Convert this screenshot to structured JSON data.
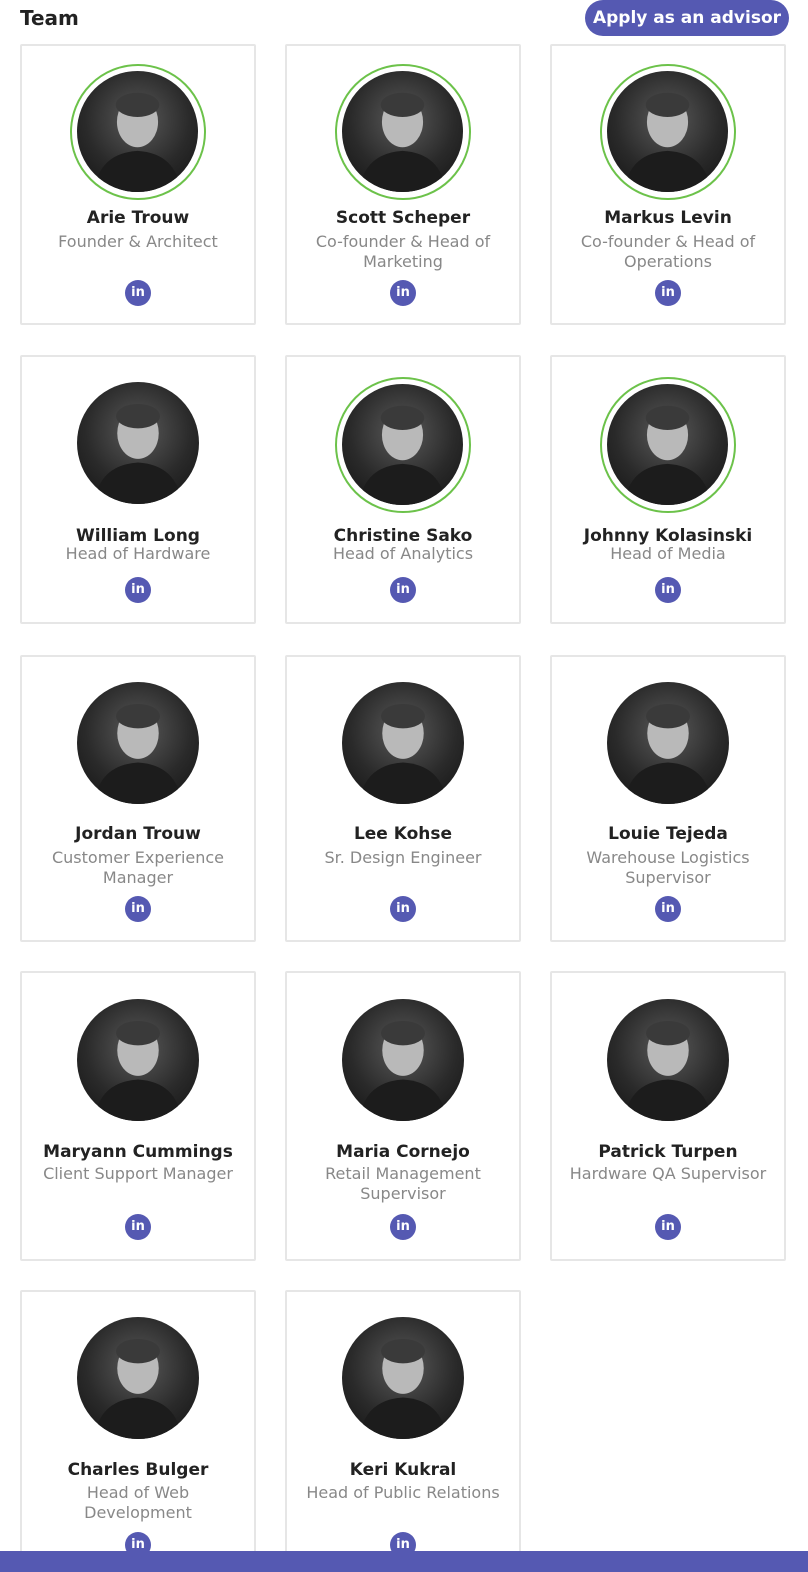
{
  "header": {
    "title": "Team",
    "apply_label": "Apply as an advisor"
  },
  "icons": {
    "linkedin": "in",
    "linkedin_name": "linkedin-icon",
    "avatar_name": "avatar"
  },
  "colors": {
    "accent": "#5559b2",
    "ring": "#6cc24a",
    "role_text": "#888888"
  },
  "team": [
    {
      "name": "Arie Trouw",
      "role": "Founder & Architect",
      "ring": true
    },
    {
      "name": "Scott Scheper",
      "role": "Co-founder & Head of Marketing",
      "ring": true
    },
    {
      "name": "Markus Levin",
      "role": "Co-founder & Head of Operations",
      "ring": true
    },
    {
      "name": "William Long",
      "role": "Head of Hardware",
      "ring": false
    },
    {
      "name": "Christine Sako",
      "role": "Head of Analytics",
      "ring": true
    },
    {
      "name": "Johnny Kolasinski",
      "role": "Head of Media",
      "ring": true
    },
    {
      "name": "Jordan Trouw",
      "role": "Customer Experience Manager",
      "ring": false
    },
    {
      "name": "Lee Kohse",
      "role": "Sr. Design Engineer",
      "ring": false
    },
    {
      "name": "Louie Tejeda",
      "role": "Warehouse Logistics Supervisor",
      "ring": false
    },
    {
      "name": "Maryann Cummings",
      "role": "Client Support Manager",
      "ring": false
    },
    {
      "name": "Maria Cornejo",
      "role": "Retail Management Supervisor",
      "ring": false
    },
    {
      "name": "Patrick Turpen",
      "role": "Hardware QA Supervisor",
      "ring": false
    },
    {
      "name": "Charles Bulger",
      "role": "Head of Web Development",
      "ring": false
    },
    {
      "name": "Keri Kukral",
      "role": "Head of Public Relations",
      "ring": false
    }
  ]
}
